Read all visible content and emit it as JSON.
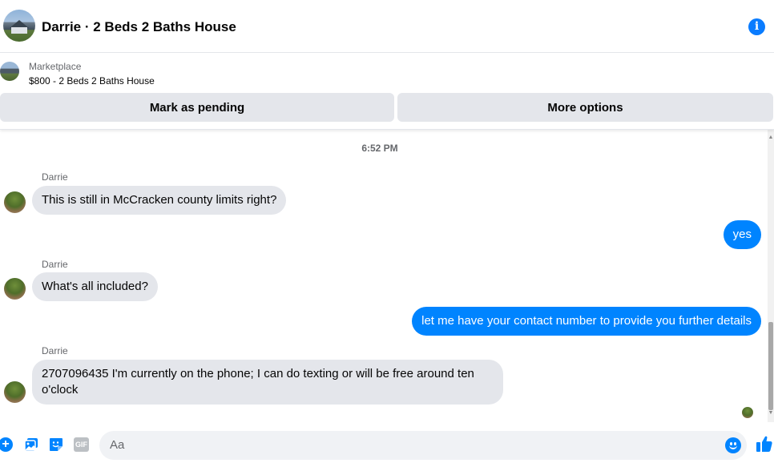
{
  "header": {
    "title": "Darrie · 2 Beds 2 Baths House",
    "info_icon": "info-icon"
  },
  "marketplace": {
    "label": "Marketplace",
    "listing": "$800 - 2 Beds 2 Baths House",
    "mark_pending_label": "Mark as pending",
    "more_options_label": "More options"
  },
  "conversation": {
    "timestamp": "6:52 PM",
    "messages": [
      {
        "direction": "incoming",
        "sender": "Darrie",
        "text": "This is still in McCracken county limits right?"
      },
      {
        "direction": "outgoing",
        "text": "yes"
      },
      {
        "direction": "incoming",
        "sender": "Darrie",
        "text": "What's all included?"
      },
      {
        "direction": "outgoing",
        "text": "let me have your contact number to provide you further details"
      },
      {
        "direction": "incoming",
        "sender": "Darrie",
        "text": "2707096435 I'm currently on the phone; I can do texting or will be free around ten o'clock"
      }
    ]
  },
  "composer": {
    "placeholder": "Aa",
    "gif_label": "GIF",
    "icons": [
      "plus-icon",
      "photo-icon",
      "sticker-icon",
      "gif-icon",
      "emoji-icon",
      "like-icon"
    ]
  },
  "colors": {
    "accent": "#0084ff",
    "incoming_bubble": "#e4e6eb",
    "button_bg": "#e4e6eb"
  }
}
